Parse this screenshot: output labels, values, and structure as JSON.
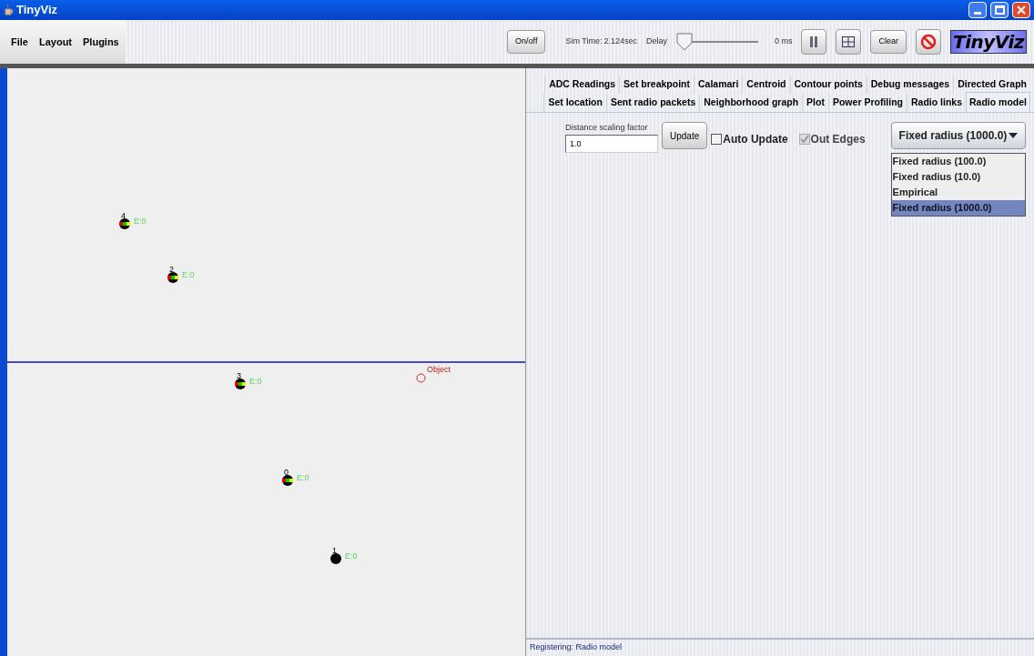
{
  "window": {
    "title": "TinyViz"
  },
  "menu": [
    "File",
    "Layout",
    "Plugins"
  ],
  "toolbar": {
    "onoff": "On/off",
    "sim_time_label": "Sim Time:",
    "sim_time": "2.124sec",
    "delay_label": "Delay",
    "delay": {
      "level": 0
    },
    "delay_reading": "0 ms",
    "clear": "Clear",
    "logo": "TinyViz"
  },
  "tab_rows": [
    [
      {
        "label": "ADC Readings",
        "selected": false
      },
      {
        "label": "Set breakpoint",
        "selected": false
      },
      {
        "label": "Calamari",
        "selected": false
      },
      {
        "label": "Centroid",
        "selected": false
      },
      {
        "label": "Contour points",
        "selected": false
      },
      {
        "label": "Debug messages",
        "selected": false
      },
      {
        "label": "Directed Graph",
        "selected": false
      }
    ],
    [
      {
        "label": "Set location",
        "selected": false
      },
      {
        "label": "Sent radio packets",
        "selected": false
      },
      {
        "label": "Neighborhood graph",
        "selected": false
      },
      {
        "label": "Plot",
        "selected": false
      },
      {
        "label": "Power Profiling",
        "selected": false
      },
      {
        "label": "Radio links",
        "selected": false
      },
      {
        "label": "Radio model",
        "selected": true
      }
    ]
  ],
  "radio_model": {
    "scaling_label": "Distance scaling factor",
    "scaling_value": "1.0",
    "update": "Update",
    "auto_update": {
      "label": "Auto Update",
      "checked": false,
      "disabled": false
    },
    "out_edges": {
      "label": "Out Edges",
      "checked": true,
      "disabled": true
    },
    "model_select": {
      "value": "Fixed radius (1000.0)",
      "expanded": true,
      "options": [
        {
          "label": "Fixed radius (100.0)",
          "selected": false
        },
        {
          "label": "Fixed radius (10.0)",
          "selected": false
        },
        {
          "label": "Empirical",
          "selected": false
        },
        {
          "label": "Fixed radius (1000.0)",
          "selected": true
        }
      ]
    }
  },
  "motes": [
    {
      "id": "4",
      "energy": "E:0",
      "kind": "leds"
    },
    {
      "id": "2",
      "energy": "E:0",
      "kind": "leds"
    },
    {
      "id": "3",
      "energy": "E:0",
      "kind": "leds"
    },
    {
      "id": "0",
      "energy": "E:0",
      "kind": "leds"
    },
    {
      "id": "1",
      "energy": "E:0",
      "kind": "plain"
    }
  ],
  "object": {
    "label": "Object"
  },
  "status_bar": "Registering: Radio model"
}
